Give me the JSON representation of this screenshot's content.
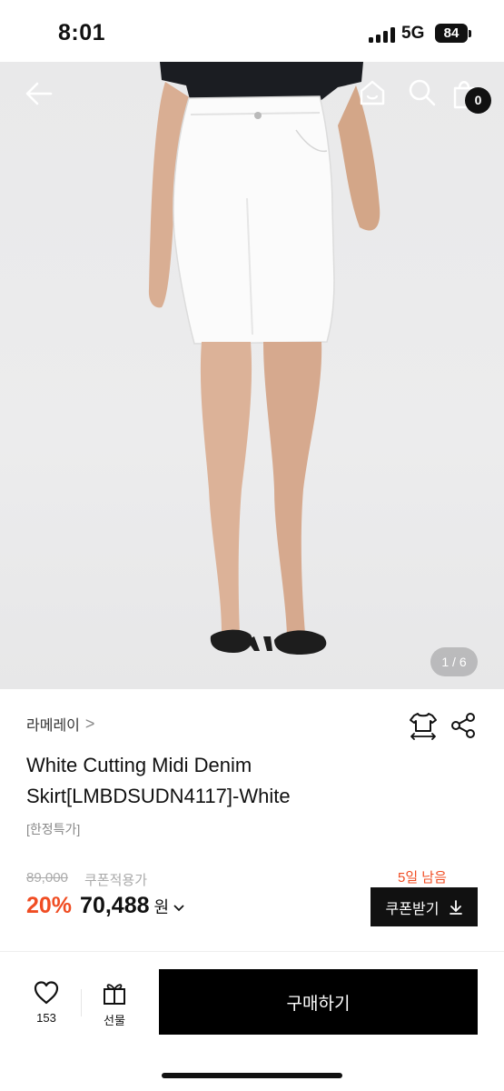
{
  "status_bar": {
    "time": "8:01",
    "network": "5G",
    "battery": "84"
  },
  "gallery": {
    "page_indicator": "1 / 6",
    "cart_count": "0",
    "icons": [
      "back-arrow-icon",
      "home-icon",
      "search-icon",
      "shopping-bag-icon"
    ]
  },
  "product": {
    "brand": "라메레이",
    "brand_chevron": ">",
    "name": "White Cutting Midi Denim Skirt[LMBDSUDN4117]-White",
    "tag": "[한정특가]",
    "original_price": "89,000",
    "coupon_price_label": "쿠폰적용가",
    "discount": "20%",
    "price": "70,488",
    "currency": "원",
    "days_left": "5일 남음",
    "coupon_button": "쿠폰받기"
  },
  "bottom_bar": {
    "like_count": "153",
    "gift_label": "선물",
    "buy_label": "구매하기"
  },
  "colors": {
    "accent": "#f04d23",
    "primary_button": "#000000"
  }
}
